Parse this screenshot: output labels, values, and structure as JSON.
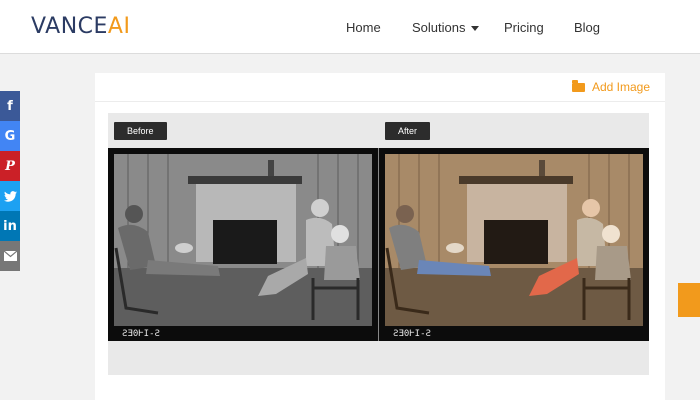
{
  "header": {
    "logo_main": "VANCE",
    "logo_accent": "AI",
    "nav": {
      "home": "Home",
      "solutions": "Solutions",
      "pricing": "Pricing",
      "blog": "Blog"
    }
  },
  "social": {
    "facebook": "f",
    "google": "G",
    "pinterest": "P",
    "twitter": "t",
    "linkedin": "in"
  },
  "card": {
    "add_image_label": "Add Image",
    "before_label": "Before",
    "after_label": "After",
    "film_code": "ƧƎ0ⱵI-Ƨ"
  },
  "colors": {
    "brand_navy": "#2b3b63",
    "brand_orange": "#f29a1c",
    "facebook": "#3b5998",
    "google": "#4285f4",
    "pinterest": "#cb2027",
    "twitter": "#1da1f2",
    "linkedin": "#0077b5",
    "email": "#777777"
  }
}
